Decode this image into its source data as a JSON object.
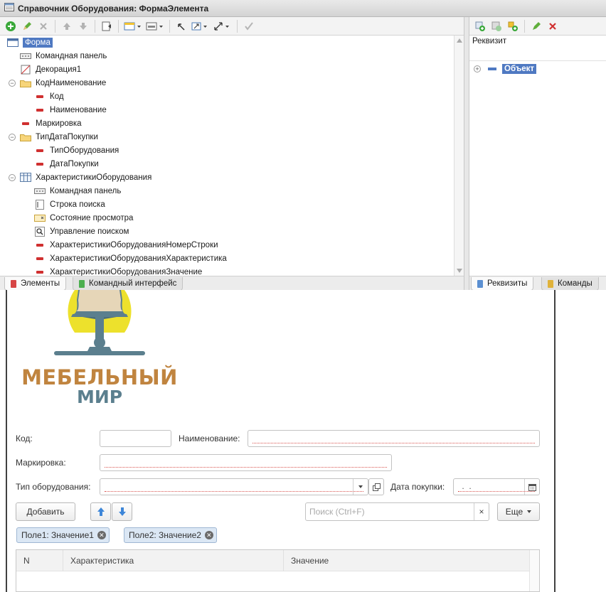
{
  "window": {
    "title": "Справочник Оборудования: ФормаЭлемента"
  },
  "toolbar_left": {
    "icons": [
      "add-icon",
      "edit-icon",
      "delete-icon",
      "move-up-icon",
      "move-down-icon",
      "goto-icon",
      "display-icon",
      "layout-icon",
      "undo-icon",
      "expand-icon",
      "resize-icon",
      "check-icon"
    ]
  },
  "tree": {
    "root": "Форма",
    "items": [
      {
        "label": "Командная панель",
        "kind": "panel"
      },
      {
        "label": "Декорация1",
        "kind": "decoration"
      },
      {
        "label": "КодНаименование",
        "kind": "group"
      },
      {
        "label": "Код",
        "kind": "field"
      },
      {
        "label": "Наименование",
        "kind": "field"
      },
      {
        "label": "Маркировка",
        "kind": "field"
      },
      {
        "label": "ТипДатаПокупки",
        "kind": "group"
      },
      {
        "label": "ТипОборудования",
        "kind": "field"
      },
      {
        "label": "ДатаПокупки",
        "kind": "field"
      },
      {
        "label": "ХарактеристикиОборудования",
        "kind": "table"
      },
      {
        "label": "Командная панель",
        "kind": "panel"
      },
      {
        "label": "Строка поиска",
        "kind": "searchstring"
      },
      {
        "label": "Состояние просмотра",
        "kind": "viewstate"
      },
      {
        "label": "Управление поиском",
        "kind": "searchctl"
      },
      {
        "label": "ХарактеристикиОборудованияНомерСтроки",
        "kind": "field"
      },
      {
        "label": "ХарактеристикиОборудованияХарактеристика",
        "kind": "field"
      },
      {
        "label": "ХарактеристикиОборудованияЗначение",
        "kind": "field"
      }
    ]
  },
  "tabs_left": {
    "elements": "Элементы",
    "command_interface": "Командный интерфейс"
  },
  "right_pane": {
    "header": "Реквизит",
    "root": "Объект"
  },
  "tabs_right": {
    "attributes": "Реквизиты",
    "commands": "Команды"
  },
  "form": {
    "logo": {
      "line1": "МЕБЕЛЬНЫЙ",
      "line2": "МИР",
      "color1": "#c0843f",
      "color2": "#5b7f8e",
      "lamp_bg": "#ede12c"
    },
    "code_label": "Код:",
    "name_label": "Наименование:",
    "marking_label": "Маркировка:",
    "type_label": "Тип оборудования:",
    "date_label": "Дата покупки:",
    "date_placeholder": " .  .",
    "add_button": "Добавить",
    "search_placeholder": "Поиск (Ctrl+F)",
    "more_button": "Еще",
    "chips": [
      {
        "label": "Поле1: Значение1"
      },
      {
        "label": "Поле2: Значение2"
      }
    ],
    "grid_columns": [
      "N",
      "Характеристика",
      "Значение"
    ]
  },
  "colors": {
    "selection": "#4f79c2",
    "required_underline": "#d9534f",
    "blue_arrow": "#3d86d8"
  }
}
